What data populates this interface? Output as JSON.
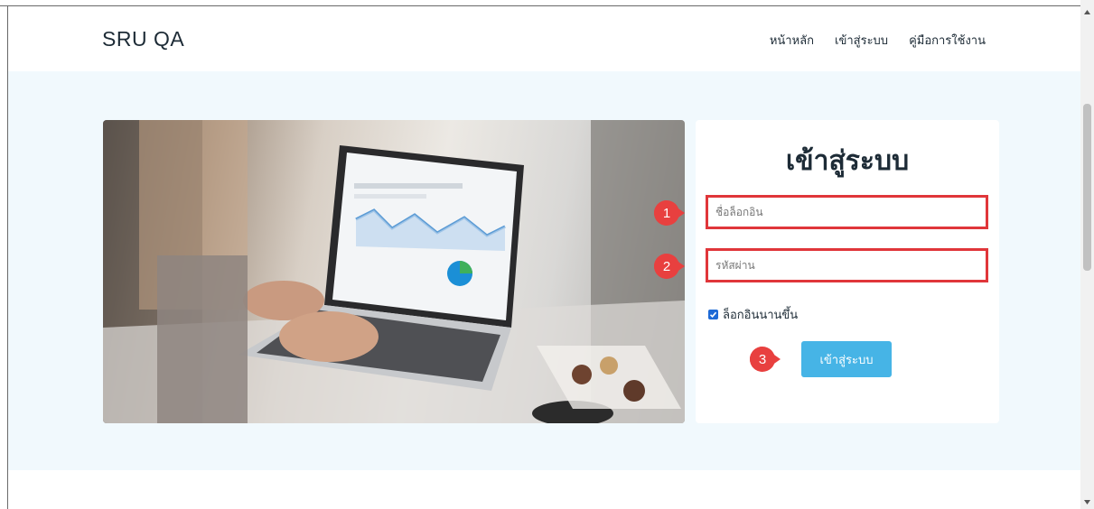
{
  "navbar": {
    "brand": "SRU QA",
    "links": [
      {
        "label": "หน้าหลัก"
      },
      {
        "label": "เข้าสู่ระบบ"
      },
      {
        "label": "คู่มือการใช้งาน"
      }
    ]
  },
  "login": {
    "title": "เข้าสู่ระบบ",
    "username_placeholder": "ชื่อล็อกอิน",
    "password_placeholder": "รหัสผ่าน",
    "remember_label": "ล็อกอินนานขึ้น",
    "remember_checked": true,
    "button_label": "เข้าสู่ระบบ"
  },
  "markers": [
    "1",
    "2",
    "3"
  ],
  "colors": {
    "hero_bg": "#f1f9fd",
    "button": "#46b4e6",
    "highlight": "#e0363a",
    "marker": "#e8403f",
    "checkbox": "#1e6ad6"
  }
}
